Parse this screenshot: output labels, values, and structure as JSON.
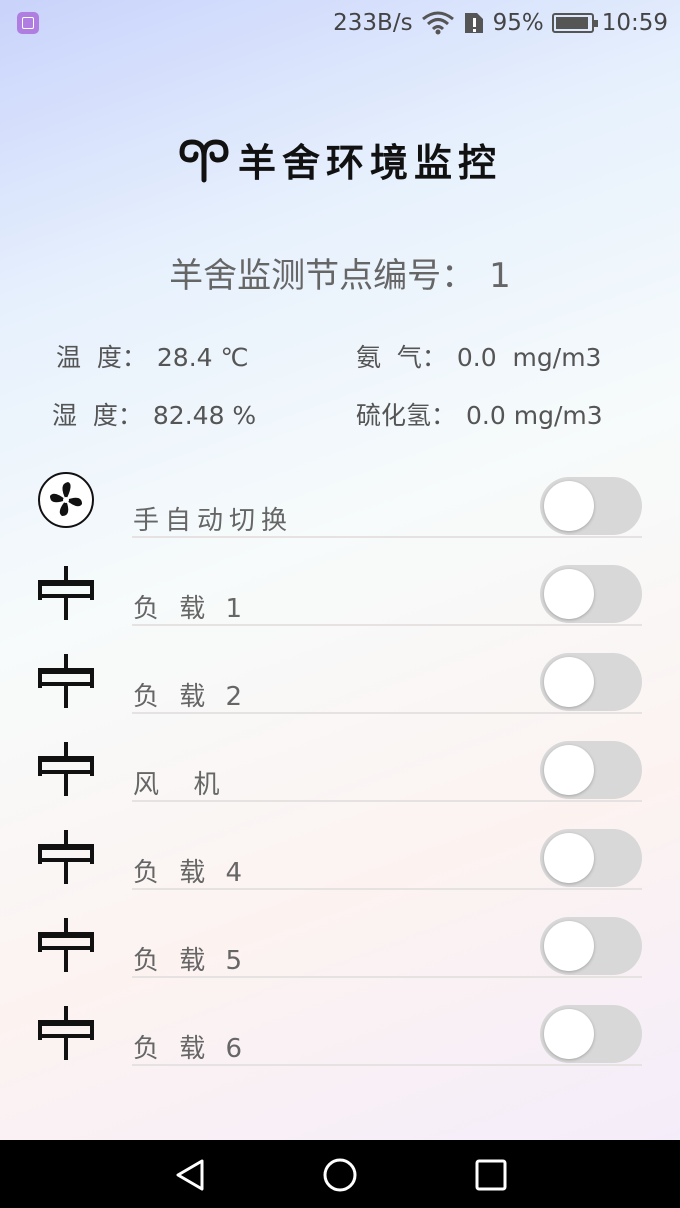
{
  "status_bar": {
    "speed": "233B/s",
    "battery_percent": "95%",
    "battery_level": 0.95,
    "time": "10:59",
    "icons": [
      "gallery-app-icon",
      "wifi-icon",
      "sim-alert-icon",
      "battery-icon"
    ]
  },
  "header": {
    "title": "羊舍环境监控",
    "logo_icon": "ram-horns-icon"
  },
  "node": {
    "label": "羊舍监测节点编号：",
    "number": "1"
  },
  "readings": [
    {
      "label": "温  度：",
      "value": "28.4 ℃"
    },
    {
      "label": "氨  气：",
      "value": "0.0  mg/m3"
    },
    {
      "label": "湿  度：",
      "value": "82.48 %"
    },
    {
      "label": "硫化氢：",
      "value": "0.0 mg/m3"
    }
  ],
  "controls": [
    {
      "label": "手自动切换",
      "icon": "fan-icon",
      "on": false
    },
    {
      "label": "负 载 1",
      "icon": "relay-icon",
      "on": false
    },
    {
      "label": "负 载 2",
      "icon": "relay-icon",
      "on": false
    },
    {
      "label": "风  机",
      "icon": "relay-icon",
      "on": false
    },
    {
      "label": "负 载 4",
      "icon": "relay-icon",
      "on": false
    },
    {
      "label": "负 载 5",
      "icon": "relay-icon",
      "on": false
    },
    {
      "label": "负 载 6",
      "icon": "relay-icon",
      "on": false
    }
  ],
  "colors": {
    "toggle_off": "#d8d8d8",
    "text_secondary": "#666666",
    "navbar": "#000000"
  },
  "navbar": {
    "buttons": [
      "back-icon",
      "home-icon",
      "recents-icon"
    ]
  }
}
